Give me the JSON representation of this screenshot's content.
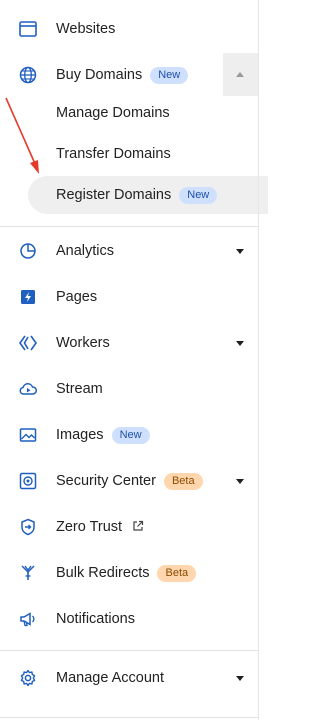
{
  "nav": {
    "websites": {
      "label": "Websites",
      "icon": "browser-window-icon"
    },
    "buy_domains": {
      "label": "Buy Domains",
      "badge": "New",
      "icon": "globe-icon"
    },
    "sub": {
      "manage": "Manage Domains",
      "transfer": "Transfer Domains",
      "register": "Register Domains",
      "register_badge": "New"
    },
    "analytics": {
      "label": "Analytics",
      "icon": "pie-chart-icon"
    },
    "pages": {
      "label": "Pages",
      "icon": "lightning-pages-icon"
    },
    "workers": {
      "label": "Workers",
      "icon": "workers-logo-icon"
    },
    "stream": {
      "label": "Stream",
      "icon": "cloud-play-icon"
    },
    "images": {
      "label": "Images",
      "badge": "New",
      "icon": "image-icon"
    },
    "security_center": {
      "label": "Security Center",
      "badge": "Beta",
      "icon": "security-center-icon"
    },
    "zero_trust": {
      "label": "Zero Trust",
      "icon": "shield-arrow-icon"
    },
    "bulk_redirects": {
      "label": "Bulk Redirects",
      "badge": "Beta",
      "icon": "funnel-icon"
    },
    "notifications": {
      "label": "Notifications",
      "icon": "megaphone-icon"
    },
    "manage_account": {
      "label": "Manage Account",
      "icon": "gear-icon"
    }
  },
  "colors": {
    "icon_blue": "#1f5fbf",
    "badge_new_bg": "#cfe0ff",
    "badge_beta_bg": "#ffd6ad",
    "annotation_red": "#e53a2a"
  }
}
